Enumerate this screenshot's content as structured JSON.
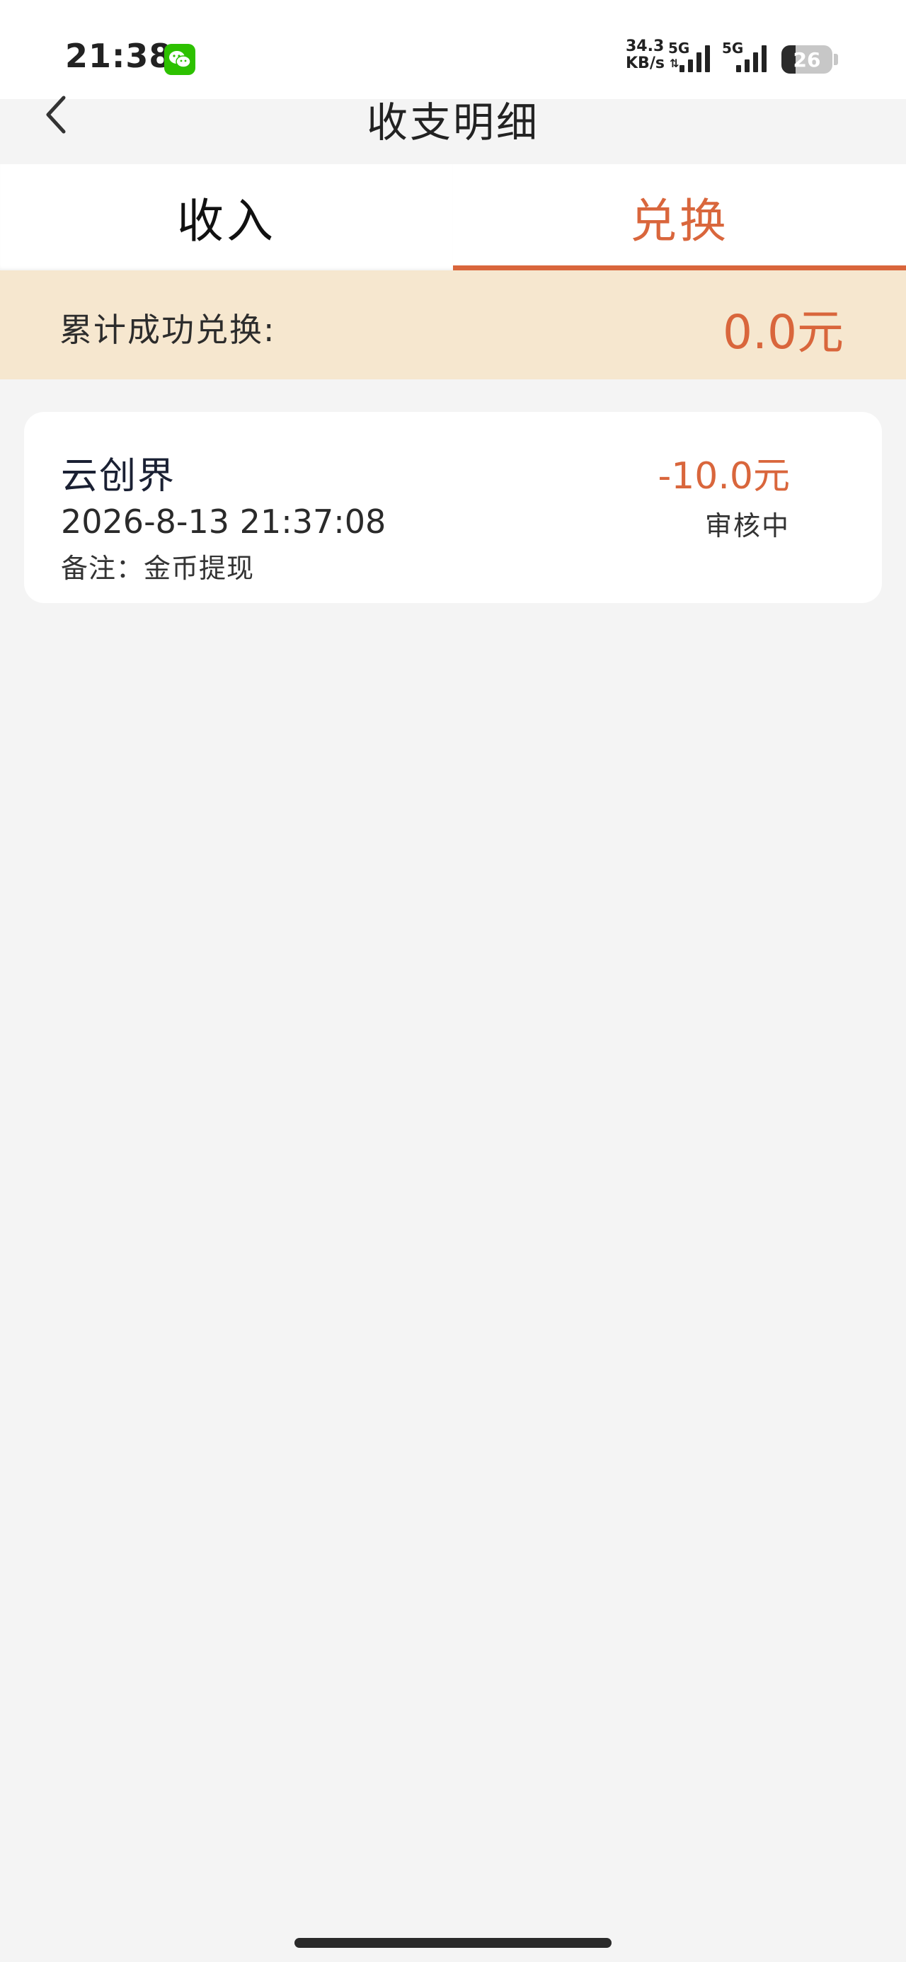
{
  "status_bar": {
    "time": "21:38",
    "net_speed_value": "34.3",
    "net_speed_unit": "KB/s",
    "signal1_label": "5G",
    "signal2_label": "5G",
    "battery": "26",
    "app_icon": "wechat-icon"
  },
  "header": {
    "title": "收支明细",
    "back_icon": "chevron-left-icon"
  },
  "tabs": [
    {
      "label": "收入",
      "active": false
    },
    {
      "label": "兑换",
      "active": true
    }
  ],
  "summary": {
    "label": "累计成功兑换:",
    "value": "0.0元"
  },
  "records": [
    {
      "name": "云创界",
      "datetime": "2026-8-13 21:37:08",
      "note": "备注：金币提现",
      "amount": "-10.0元",
      "status": "审核中"
    }
  ],
  "colors": {
    "accent": "#d9663c",
    "summary_bg": "#f6e7cf",
    "page_bg": "#f4f4f4"
  }
}
